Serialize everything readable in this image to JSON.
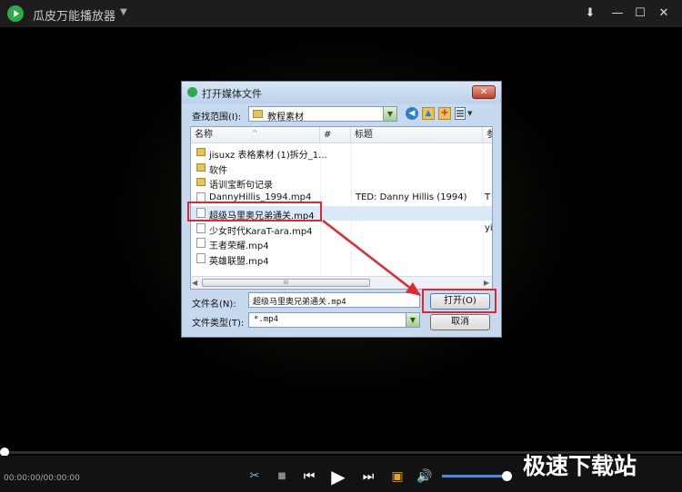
{
  "app": {
    "title": "瓜皮万能播放器",
    "menu_glyph": "▼",
    "controls": {
      "download": "⬇",
      "minimize": "—",
      "maximize": "☐",
      "close": "✕"
    }
  },
  "dialog": {
    "title": "打开媒体文件",
    "close": "✕",
    "lookin_label": "查找范围(I):",
    "lookin_value": "教程素材",
    "combo_arrow": "▼",
    "nav_icons": [
      "back-icon",
      "up-folder-icon",
      "new-folder-icon",
      "view-menu-icon"
    ],
    "columns": {
      "name": "名称",
      "number": "#",
      "title": "标题",
      "extra": "参"
    },
    "files": [
      {
        "name": "jisuxz 表格素材 (1)拆分_1...",
        "title": "",
        "extra": "",
        "type": "folder"
      },
      {
        "name": "软件",
        "title": "",
        "extra": "",
        "type": "folder"
      },
      {
        "name": "语训宝断句记录",
        "title": "",
        "extra": "",
        "type": "folder"
      },
      {
        "name": "DannyHillis_1994.mp4",
        "title": "TED: Danny Hillis (1994)",
        "extra": "T",
        "type": "file"
      },
      {
        "name": "超级马里奥兄弟通关.mp4",
        "title": "",
        "extra": "",
        "type": "file",
        "selected": true
      },
      {
        "name": "少女时代KaraT-ara.mp4",
        "title": "",
        "extra": "yi",
        "type": "file"
      },
      {
        "name": "王者荣耀.mp4",
        "title": "",
        "extra": "",
        "type": "file"
      },
      {
        "name": "英雄联盟.mp4",
        "title": "",
        "extra": "",
        "type": "file"
      }
    ],
    "scroll_grip": "III",
    "filename_label": "文件名(N):",
    "filename_value": "超级马里奥兄弟通关.mp4",
    "filetype_label": "文件类型(T):",
    "filetype_value": "*.mp4",
    "open_button": "打开(O)",
    "cancel_button": "取消"
  },
  "player": {
    "time": "00:00:00/00:00:00",
    "progress": 0,
    "volume": 0.92,
    "watermark": "极速下载站"
  },
  "colors": {
    "accent_green": "#2faa4a",
    "annotation_red": "#e1262f",
    "volume_blue": "#3a8ee6"
  }
}
